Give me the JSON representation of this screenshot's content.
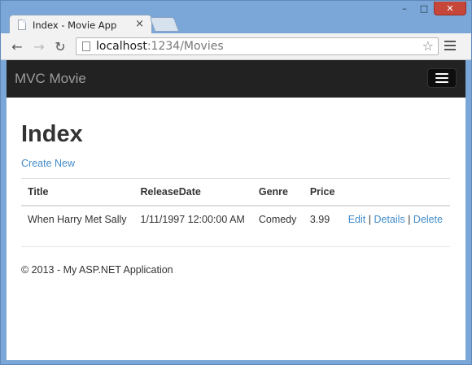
{
  "browser": {
    "tab_title": "Index - Movie App",
    "tab_close": "×",
    "url_host": "localhost",
    "url_path": ":1234/Movies",
    "controls": {
      "minimize": "–",
      "maximize": "□",
      "close": "✕"
    },
    "icons": {
      "back": "back-arrow-icon",
      "forward": "forward-arrow-icon",
      "reload": "reload-icon",
      "star": "star-icon",
      "menu": "menu-icon"
    }
  },
  "navbar": {
    "brand": "MVC Movie"
  },
  "main": {
    "title": "Index",
    "create_link": "Create New",
    "table": {
      "headers": [
        "Title",
        "ReleaseDate",
        "Genre",
        "Price"
      ],
      "rows": [
        {
          "title": "When Harry Met Sally",
          "release_date": "1/11/1997 12:00:00 AM",
          "genre": "Comedy",
          "price": "3.99",
          "actions": {
            "edit": "Edit",
            "details": "Details",
            "delete": "Delete",
            "separator": "|"
          }
        }
      ]
    }
  },
  "footer": {
    "text": "© 2013 - My ASP.NET Application"
  },
  "colors": {
    "navbar": "#222222",
    "link": "#428bca",
    "brand": "#9d9d9d"
  }
}
